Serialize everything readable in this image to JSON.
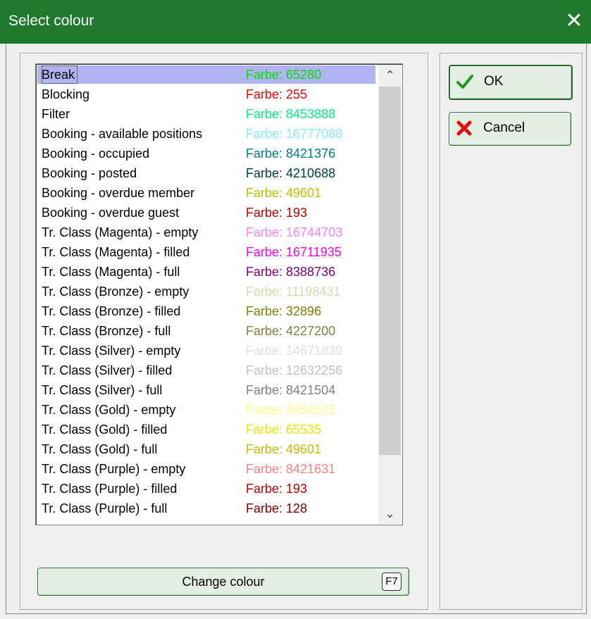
{
  "window": {
    "title": "Select colour",
    "close_glyph": "✕"
  },
  "list": {
    "items": [
      {
        "name": "Break",
        "value": "Farbe: 65280",
        "color": "#00e000",
        "selected": true
      },
      {
        "name": "Blocking",
        "value": "Farbe: 255",
        "color": "#ff0000"
      },
      {
        "name": "Filter",
        "value": "Farbe: 8453888",
        "color": "#00f080"
      },
      {
        "name": "Booking - available positions",
        "value": "Farbe: 16777088",
        "color": "#80f0ff"
      },
      {
        "name": "Booking - occupied",
        "value": "Farbe: 8421376",
        "color": "#008080"
      },
      {
        "name": "Booking - posted",
        "value": "Farbe: 4210688",
        "color": "#004040"
      },
      {
        "name": "Booking - overdue member",
        "value": "Farbe: 49601",
        "color": "#c0c000"
      },
      {
        "name": "Booking - overdue guest",
        "value": "Farbe: 193",
        "color": "#c10000"
      },
      {
        "name": "Tr. Class (Magenta) - empty",
        "value": "Farbe: 16744703",
        "color": "#ff80ff"
      },
      {
        "name": "Tr. Class (Magenta) - filled",
        "value": "Farbe: 16711935",
        "color": "#ff00ff"
      },
      {
        "name": "Tr. Class (Magenta) - full",
        "value": "Farbe: 8388736",
        "color": "#800080"
      },
      {
        "name": "Tr. Class (Bronze) - empty",
        "value": "Farbe: 11198431",
        "color": "#d8d8b0"
      },
      {
        "name": "Tr. Class (Bronze) - filled",
        "value": "Farbe: 32896",
        "color": "#808000"
      },
      {
        "name": "Tr. Class (Bronze) - full",
        "value": "Farbe: 4227200",
        "color": "#808040"
      },
      {
        "name": "Tr. Class (Silver) - empty",
        "value": "Farbe: 14671839",
        "color": "#dfdfdf"
      },
      {
        "name": "Tr. Class (Silver) - filled",
        "value": "Farbe: 12632256",
        "color": "#c0c0c0"
      },
      {
        "name": "Tr. Class (Silver) - full",
        "value": "Farbe: 8421504",
        "color": "#808080"
      },
      {
        "name": "Tr. Class (Gold) - empty",
        "value": "Farbe: 8454143",
        "color": "#ffff80"
      },
      {
        "name": "Tr. Class (Gold) - filled",
        "value": "Farbe: 65535",
        "color": "#e8e800"
      },
      {
        "name": "Tr. Class (Gold) - full",
        "value": "Farbe: 49601",
        "color": "#c0c000"
      },
      {
        "name": "Tr. Class (Purple) - empty",
        "value": "Farbe: 8421631",
        "color": "#ff8080"
      },
      {
        "name": "Tr. Class (Purple) - filled",
        "value": "Farbe: 193",
        "color": "#c10000"
      },
      {
        "name": "Tr. Class (Purple) - full",
        "value": "Farbe: 128",
        "color": "#800000"
      }
    ]
  },
  "buttons": {
    "ok": {
      "label": "OK",
      "icon": "check-icon"
    },
    "cancel": {
      "label": "Cancel",
      "icon": "x-icon"
    },
    "change": {
      "label": "Change colour",
      "shortcut": "F7"
    }
  },
  "scrollbar": {
    "up_glyph": "⌃",
    "down_glyph": "⌄"
  },
  "colors": {
    "titlebar": "#1f7a2e",
    "selection": "#b0b4f0"
  }
}
